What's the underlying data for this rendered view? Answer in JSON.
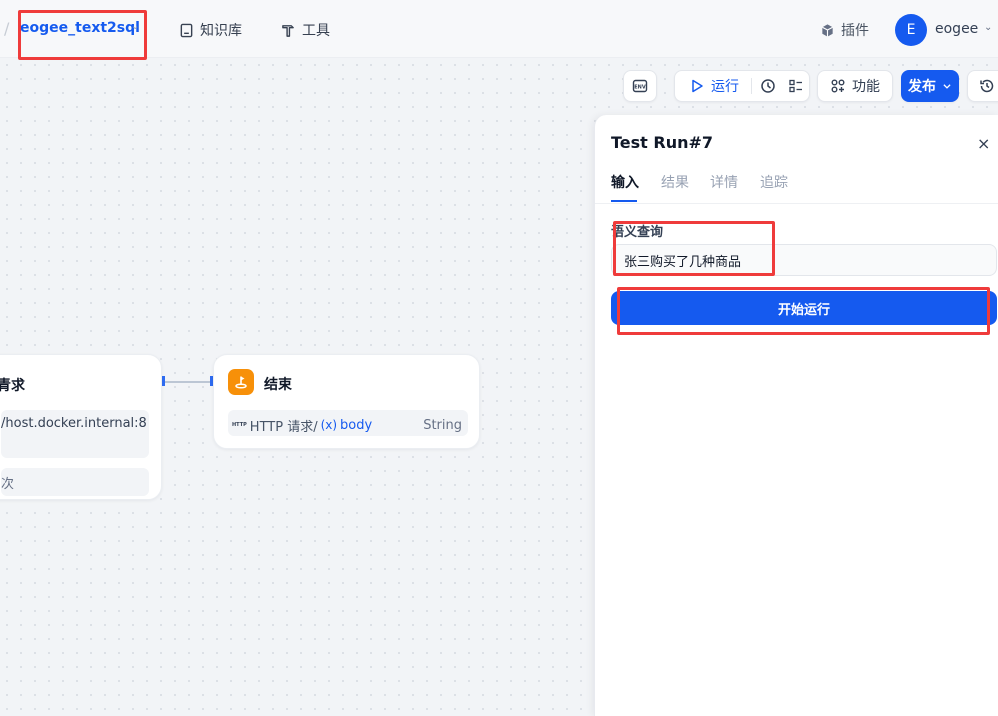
{
  "header": {
    "separator": "/",
    "app_name": "eogee_text2sql",
    "nav": {
      "knowledge": "知识库",
      "tools": "工具"
    },
    "plugin_label": "插件",
    "user": {
      "avatar_letter": "E",
      "name": "eogee"
    }
  },
  "toolbar": {
    "env_label": "ENV",
    "run_label": "运行",
    "features_label": "功能",
    "publish_label": "发布"
  },
  "canvas": {
    "http_node": {
      "title_fragment": "青求",
      "url_fragment": "/host.docker.internal:8",
      "retry_fragment": "次"
    },
    "end_node": {
      "title": "结束",
      "output": {
        "source_tag": "HTTP",
        "source_name": "HTTP 请求/",
        "var_icon": "(x)",
        "var_name": "body",
        "type": "String"
      }
    }
  },
  "panel": {
    "title": "Test Run#7",
    "close": "×",
    "tabs": [
      {
        "label": "输入"
      },
      {
        "label": "结果"
      },
      {
        "label": "详情"
      },
      {
        "label": "追踪"
      }
    ],
    "field_label": "语义查询",
    "query_value": "张三购买了几种商品",
    "run_button": "开始运行"
  },
  "colors": {
    "accent": "#155aef",
    "highlight": "#ef3b3b",
    "end_node": "#f79009"
  }
}
